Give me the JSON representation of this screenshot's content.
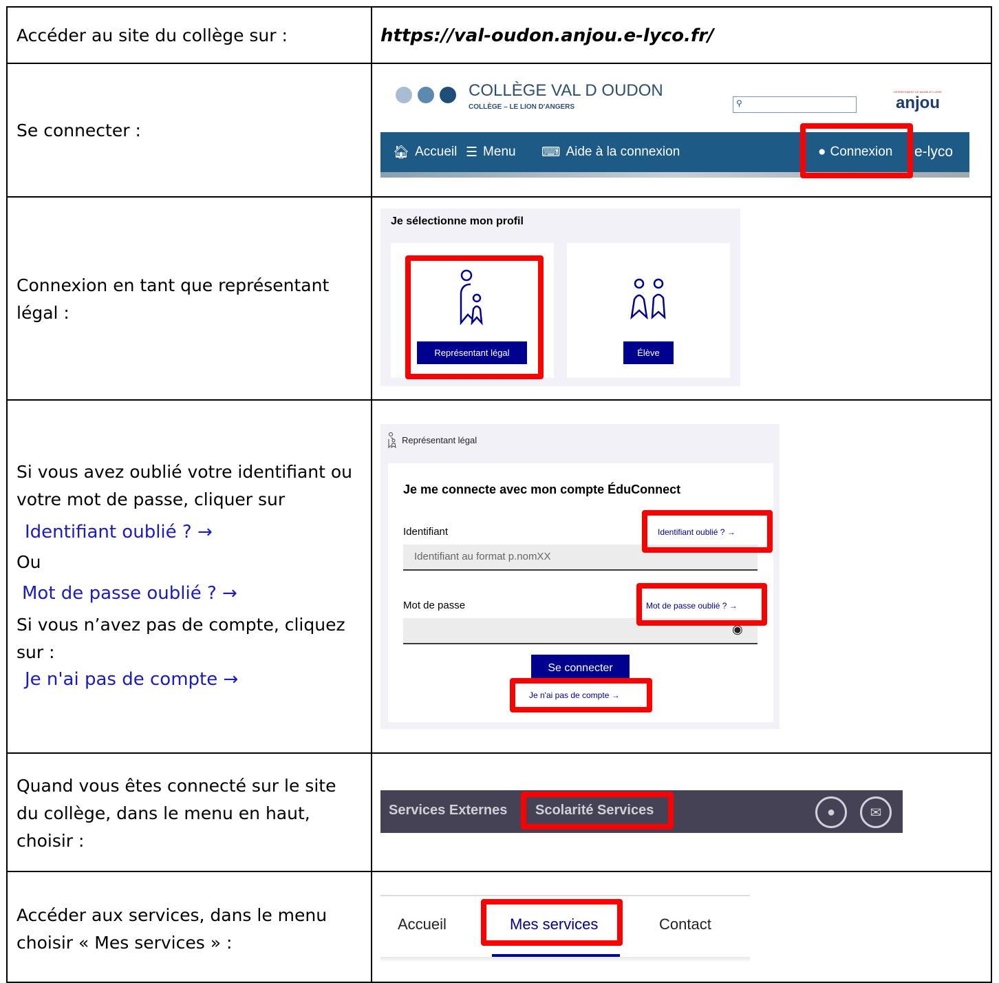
{
  "rows": {
    "r1": {
      "label": "Accéder au site du collège sur :",
      "url": "https://val-oudon.anjou.e-lyco.fr/"
    },
    "r2": {
      "label": "Se connecter :",
      "site": {
        "name": "COLLÈGE VAL D OUDON",
        "sub": "COLLÈGE – LE LION D'ANGERS",
        "dept_small": "DÉPARTEMENT DE MAINE-ET-LOIRE",
        "dept": "anjou",
        "nav": {
          "home": "Accueil",
          "menu": "Menu",
          "help": "Aide à la connexion",
          "login": "Connexion",
          "brand": "e-lyco"
        }
      }
    },
    "r3": {
      "label": "Connexion en tant que représentant légal :",
      "panel": {
        "title": "Je sélectionne mon profil",
        "legal_button": "Représentant légal",
        "student_button": "Élève"
      }
    },
    "r4": {
      "label_1": "Si vous avez oublié votre identifiant ou votre mot de passe, cliquer sur",
      "forgot_id": "Identifiant oublié ?  →",
      "or": "Ou",
      "forgot_pw": "Mot de passe oublié ?  →",
      "label_2": "Si vous n’avez pas de compte, cliquez sur :",
      "no_account": "Je n'ai pas de compte  →",
      "form": {
        "profile": "Représentant légal",
        "heading": "Je me connecte avec mon compte ÉduConnect",
        "id_label": "Identifiant",
        "id_link": "Identifiant oublié ?  →",
        "id_placeholder": "Identifiant au format p.nomXX",
        "pw_label": "Mot de passe",
        "pw_link": "Mot de passe oublié ?  →",
        "submit": "Se connecter",
        "no_account": "Je n'ai pas de compte  →"
      }
    },
    "r5": {
      "label": "Quand vous êtes connecté sur le site du collège, dans le menu en haut, choisir :",
      "bar": {
        "external": "Services Externes",
        "school": "Scolarité Services"
      }
    },
    "r6": {
      "label": "Accéder aux services, dans le menu choisir « Mes services » :",
      "tabs": {
        "home": "Accueil",
        "services": "Mes services",
        "contact": "Contact"
      }
    }
  },
  "colors": {
    "highlight": "#ff0000",
    "educonnect_blue": "#00008f",
    "elyco_nav": "#1d5a86",
    "services_bar": "#464255"
  }
}
